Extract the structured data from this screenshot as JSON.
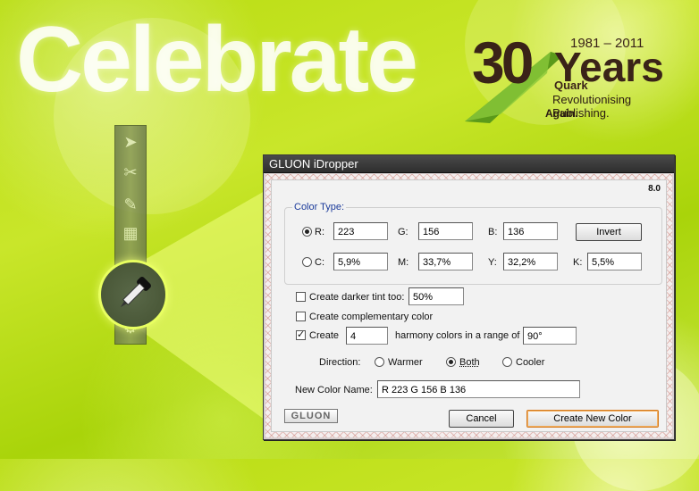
{
  "background": {
    "headline": "Celebrate",
    "logo": {
      "number": "30",
      "word": "Years",
      "range": "1981 – 2011",
      "brand": "Quark",
      "tagline": "Revolutionising Publishing.",
      "again": "Again."
    },
    "colors": {
      "bg_green": "#b8dc10",
      "logo_brown": "#3a2318",
      "chevron_green": "#5a9a1a"
    }
  },
  "toolbar": {
    "tools": [
      "pointer-tool-icon",
      "scissors-tool-icon",
      "pen-tool-icon",
      "grid-tool-icon",
      "eyedropper-tool-icon"
    ]
  },
  "dialog": {
    "title": "GLUON iDropper",
    "version": "8.0",
    "color_type": {
      "title": "Color Type:",
      "rgb": {
        "selected": true,
        "r_label": "R:",
        "r_value": "223",
        "g_label": "G:",
        "g_value": "156",
        "b_label": "B:",
        "b_value": "136",
        "invert_label": "Invert"
      },
      "cmyk": {
        "selected": false,
        "c_label": "C:",
        "c_value": "5,9%",
        "m_label": "M:",
        "m_value": "33,7%",
        "y_label": "Y:",
        "y_value": "32,2%",
        "k_label": "K:",
        "k_value": "5,5%"
      }
    },
    "darker_tint": {
      "checked": false,
      "label": "Create darker tint too:",
      "value": "50%"
    },
    "complementary": {
      "checked": false,
      "label": "Create complementary color"
    },
    "harmony": {
      "checked": true,
      "label": "Create",
      "count": "4",
      "middle_label": "harmony colors in a range of",
      "range": "90°"
    },
    "direction": {
      "label": "Direction:",
      "options": [
        {
          "label": "Warmer",
          "selected": false
        },
        {
          "label": "Both",
          "selected": true
        },
        {
          "label": "Cooler",
          "selected": false
        }
      ]
    },
    "new_color_name": {
      "label": "New Color Name:",
      "value": "R 223 G 156 B 136"
    },
    "logo_text": "GLUON",
    "cancel_label": "Cancel",
    "create_label": "Create New Color"
  }
}
